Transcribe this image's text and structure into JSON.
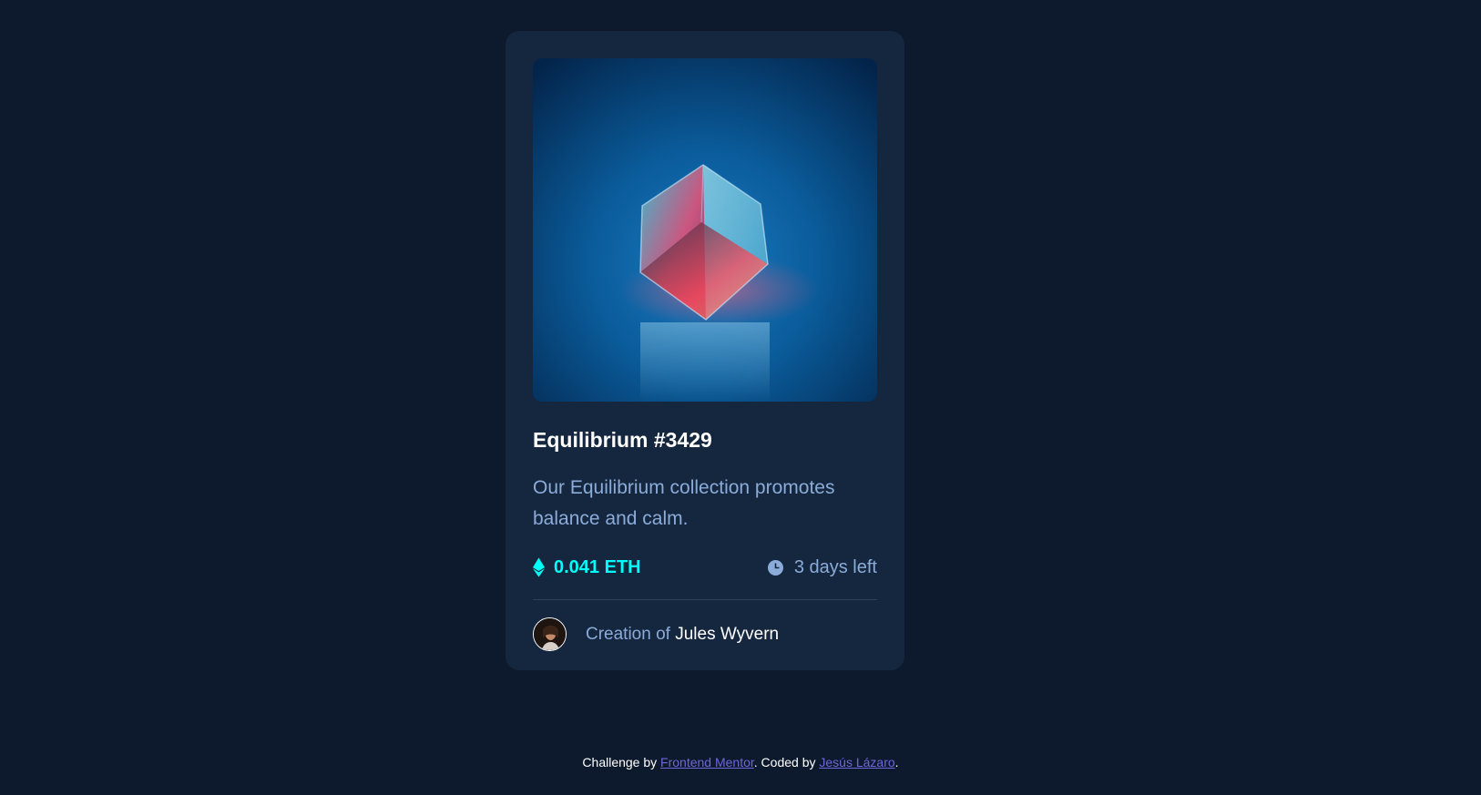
{
  "card": {
    "image_alt": "Equilibrium image",
    "title": "Equilibrium #3429",
    "description": "Our Equilibrium collection promotes balance and calm.",
    "price": {
      "icon": "ethereum-icon",
      "value": "0.041 ETH"
    },
    "time": {
      "icon": "clock-icon",
      "value": "3 days left"
    },
    "creator": {
      "prefix": "Creation of",
      "name": "Jules Wyvern"
    }
  },
  "attribution": {
    "challenge_prefix": "Challenge by",
    "challenge_link": "Frontend Mentor",
    "coded_prefix": ". Coded by",
    "coded_link": "Jesús Lázaro",
    "suffix": "."
  },
  "colors": {
    "page_background": "#0d1a2d",
    "card_background": "#15263f",
    "soft_blue": "#8bacd9",
    "cyan": "#00fff8",
    "white": "#ffffff",
    "link": "#6f66d9"
  }
}
